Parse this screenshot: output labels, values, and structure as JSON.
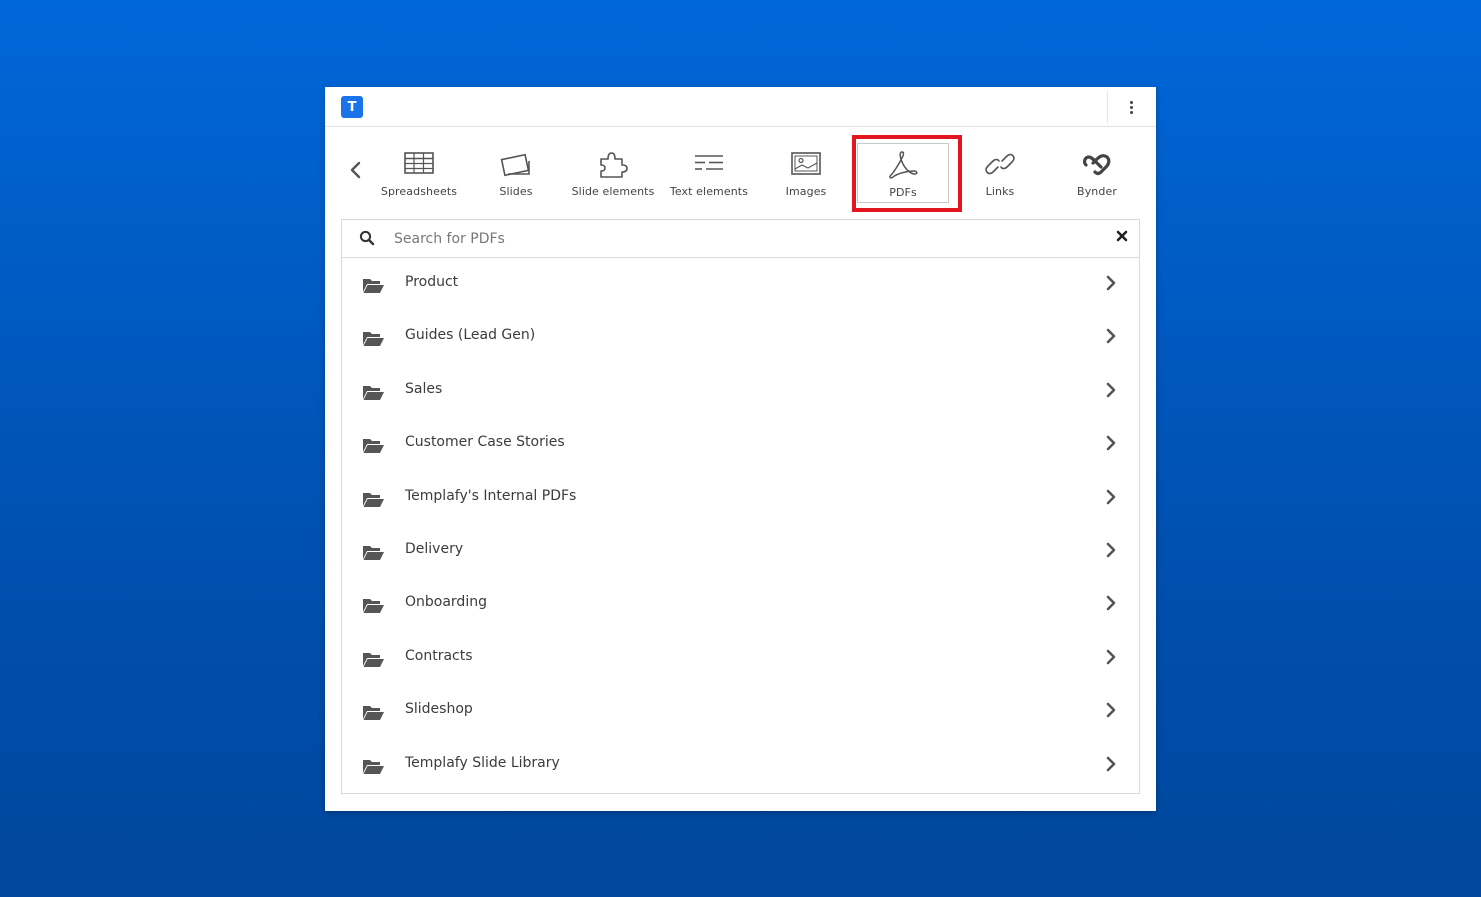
{
  "app": {
    "logo_letter": "T",
    "brand_color": "#1a73e8",
    "highlight_color": "#e3151f"
  },
  "categories": [
    {
      "label": "Spreadsheets",
      "icon": "spreadsheet-icon"
    },
    {
      "label": "Slides",
      "icon": "slides-icon"
    },
    {
      "label": "Slide elements",
      "icon": "puzzle-icon"
    },
    {
      "label": "Text elements",
      "icon": "text-lines-icon"
    },
    {
      "label": "Images",
      "icon": "image-icon"
    },
    {
      "label": "PDFs",
      "icon": "pdf-icon",
      "selected": true
    },
    {
      "label": "Links",
      "icon": "link-icon"
    },
    {
      "label": "Bynder",
      "icon": "bynder-icon"
    }
  ],
  "search": {
    "placeholder": "Search for PDFs",
    "value": ""
  },
  "folders": [
    {
      "name": "Product"
    },
    {
      "name": "Guides (Lead Gen)"
    },
    {
      "name": "Sales"
    },
    {
      "name": "Customer Case Stories"
    },
    {
      "name": "Templafy's Internal PDFs"
    },
    {
      "name": "Delivery"
    },
    {
      "name": "Onboarding"
    },
    {
      "name": "Contracts"
    },
    {
      "name": "Slideshop"
    },
    {
      "name": "Templafy Slide Library"
    }
  ]
}
